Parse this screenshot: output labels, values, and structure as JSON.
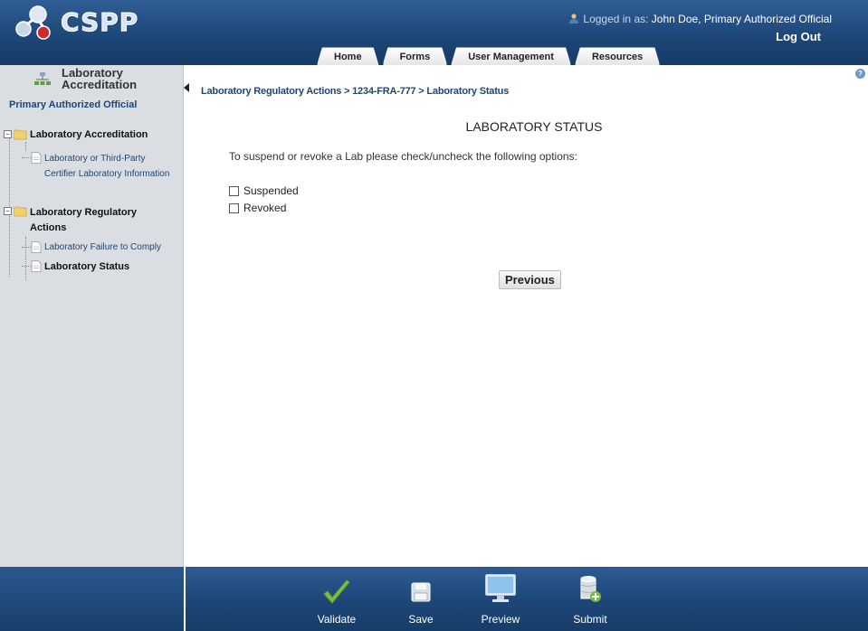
{
  "header": {
    "app_name": "CSPP",
    "login_prefix": "Logged in as:",
    "login_user": "John Doe, Primary Authorized Official",
    "logout_label": "Log Out",
    "tabs": [
      {
        "label": "Home"
      },
      {
        "label": "Forms"
      },
      {
        "label": "User Management"
      },
      {
        "label": "Resources"
      }
    ]
  },
  "sidebar": {
    "title": "Laboratory Accreditation",
    "role": "Primary Authorized Official",
    "tree": [
      {
        "label": "Laboratory Accreditation",
        "toggle": "−",
        "children": [
          {
            "label": "Laboratory or Third-Party Certifier Laboratory Information",
            "active": false
          }
        ]
      },
      {
        "label": "Laboratory Regulatory Actions",
        "toggle": "−",
        "children": [
          {
            "label": "Laboratory Failure to Comply",
            "active": false
          },
          {
            "label": "Laboratory Status",
            "active": true
          }
        ]
      }
    ]
  },
  "main": {
    "breadcrumb": "Laboratory Regulatory Actions > 1234-FRA-777 > Laboratory Status",
    "title": "LABORATORY STATUS",
    "instructions": "To suspend or revoke a Lab please check/uncheck the following options:",
    "options": [
      {
        "label": "Suspended",
        "checked": false
      },
      {
        "label": "Revoked",
        "checked": false
      }
    ],
    "previous_label": "Previous",
    "help_icon": "?"
  },
  "footer": {
    "buttons": [
      {
        "label": "Validate",
        "icon": "checkmark-icon"
      },
      {
        "label": "Save",
        "icon": "floppy-disk-icon"
      },
      {
        "label": "Preview",
        "icon": "monitor-icon"
      },
      {
        "label": "Submit",
        "icon": "database-add-icon"
      }
    ]
  },
  "colors": {
    "header_blue": "#1c4677",
    "sidebar_bg": "#dadde1",
    "link_blue": "#1c4677",
    "validate_green": "#7cc242"
  }
}
